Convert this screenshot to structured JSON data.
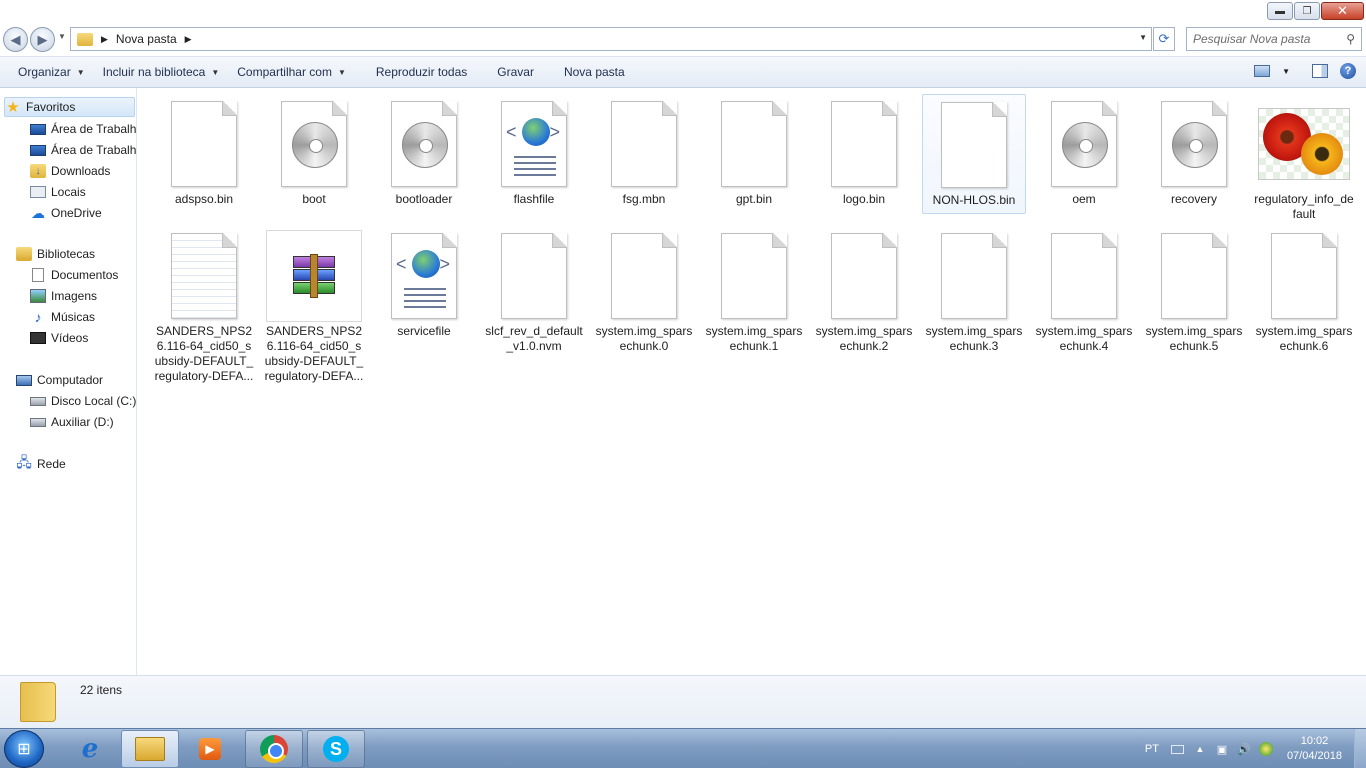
{
  "window": {
    "buttons": {
      "minimize": "▬",
      "maximize": "❐",
      "close": "✕"
    }
  },
  "address": {
    "crumb": "Nova pasta",
    "search_placeholder": "Pesquisar Nova pasta"
  },
  "toolbar": {
    "organize": "Organizar",
    "include_library": "Incluir na biblioteca",
    "share": "Compartilhar com",
    "play_all": "Reproduzir todas",
    "burn": "Gravar",
    "new_folder": "Nova pasta",
    "help": "?"
  },
  "sidebar": {
    "favorites": "Favoritos",
    "favorite_items": [
      "Área de Trabalh",
      "Área de Trabalh",
      "Downloads",
      "Locais",
      "OneDrive"
    ],
    "libraries": "Bibliotecas",
    "library_items": [
      "Documentos",
      "Imagens",
      "Músicas",
      "Vídeos"
    ],
    "computer": "Computador",
    "computer_items": [
      "Disco Local (C:)",
      "Auxiliar (D:)"
    ],
    "network": "Rede"
  },
  "files": [
    {
      "name": "adspso.bin",
      "icon": "blank-file-icon"
    },
    {
      "name": "boot",
      "icon": "disc-image-icon"
    },
    {
      "name": "bootloader",
      "icon": "disc-image-icon"
    },
    {
      "name": "flashfile",
      "icon": "html-file-icon"
    },
    {
      "name": "fsg.mbn",
      "icon": "blank-file-icon"
    },
    {
      "name": "gpt.bin",
      "icon": "blank-file-icon"
    },
    {
      "name": "logo.bin",
      "icon": "blank-file-icon"
    },
    {
      "name": "NON-HLOS.bin",
      "icon": "blank-file-icon"
    },
    {
      "name": "oem",
      "icon": "disc-image-icon"
    },
    {
      "name": "recovery",
      "icon": "disc-image-icon"
    },
    {
      "name": "regulatory_info_default",
      "icon": "image-thumbnail-icon"
    },
    {
      "name": "SANDERS_NPS26.116-64_cid50_subsidy-DEFAULT_regulatory-DEFA...",
      "icon": "text-file-icon"
    },
    {
      "name": "SANDERS_NPS26.116-64_cid50_subsidy-DEFAULT_regulatory-DEFA...",
      "icon": "winrar-archive-icon"
    },
    {
      "name": "servicefile",
      "icon": "html-file-icon"
    },
    {
      "name": "slcf_rev_d_default_v1.0.nvm",
      "icon": "blank-file-icon"
    },
    {
      "name": "system.img_sparsechunk.0",
      "icon": "blank-file-icon"
    },
    {
      "name": "system.img_sparsechunk.1",
      "icon": "blank-file-icon"
    },
    {
      "name": "system.img_sparsechunk.2",
      "icon": "blank-file-icon"
    },
    {
      "name": "system.img_sparsechunk.3",
      "icon": "blank-file-icon"
    },
    {
      "name": "system.img_sparsechunk.4",
      "icon": "blank-file-icon"
    },
    {
      "name": "system.img_sparsechunk.5",
      "icon": "blank-file-icon"
    },
    {
      "name": "system.img_sparsechunk.6",
      "icon": "blank-file-icon"
    }
  ],
  "details": {
    "count": "22 itens"
  },
  "taskbar": {
    "lang": "PT",
    "time": "10:02",
    "date": "07/04/2018"
  }
}
